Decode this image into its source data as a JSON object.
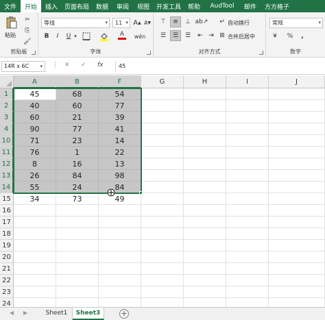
{
  "ribbon_tabs": [
    {
      "label": "文件",
      "active": false
    },
    {
      "label": "开始",
      "active": true
    },
    {
      "label": "插入",
      "active": false
    },
    {
      "label": "页面布局",
      "active": false
    },
    {
      "label": "数据",
      "active": false
    },
    {
      "label": "审阅",
      "active": false
    },
    {
      "label": "视图",
      "active": false
    },
    {
      "label": "开发工具",
      "active": false
    },
    {
      "label": "帮助",
      "active": false
    },
    {
      "label": "AudTool",
      "active": false
    },
    {
      "label": "邮件",
      "active": false
    },
    {
      "label": "方方格子",
      "active": false
    }
  ],
  "clipboard": {
    "paste_label": "粘贴",
    "group_label": "剪贴板"
  },
  "font": {
    "name": "等线",
    "size": "11",
    "group_label": "字体",
    "grow_label": "A",
    "shrink_label": "A",
    "bold": "B",
    "italic": "I",
    "underline": "U",
    "font_color_label": "A",
    "fill_color_label": "A"
  },
  "alignment": {
    "wrap_label": "自动换行",
    "merge_label": "合并后居中",
    "group_label": "对齐方式"
  },
  "number": {
    "format": "常规",
    "group_label": "数字",
    "percent": "%",
    "comma": ","
  },
  "formula_bar": {
    "name_box": "14R x 6C",
    "cancel": "✕",
    "enter": "✓",
    "fx": "fx",
    "value": "45"
  },
  "columns": [
    "A",
    "B",
    "F",
    "G",
    "H",
    "I",
    "J"
  ],
  "selected_columns": [
    "A",
    "B",
    "F"
  ],
  "rows": [
    {
      "num": "1",
      "cells": [
        "45",
        "68",
        "54"
      ],
      "selected": true
    },
    {
      "num": "2",
      "cells": [
        "40",
        "60",
        "77"
      ],
      "selected": true
    },
    {
      "num": "3",
      "cells": [
        "60",
        "21",
        "39"
      ],
      "selected": true
    },
    {
      "num": "4",
      "cells": [
        "90",
        "77",
        "41"
      ],
      "selected": true
    },
    {
      "num": "10",
      "cells": [
        "71",
        "23",
        "14"
      ],
      "selected": true
    },
    {
      "num": "11",
      "cells": [
        "76",
        "1",
        "22"
      ],
      "selected": true
    },
    {
      "num": "12",
      "cells": [
        "8",
        "16",
        "13"
      ],
      "selected": true
    },
    {
      "num": "13",
      "cells": [
        "26",
        "84",
        "98"
      ],
      "selected": true
    },
    {
      "num": "14",
      "cells": [
        "55",
        "24",
        "84"
      ],
      "selected": true
    },
    {
      "num": "15",
      "cells": [
        "34",
        "73",
        "49"
      ],
      "selected": false
    },
    {
      "num": "16",
      "cells": [
        "",
        "",
        ""
      ],
      "selected": false
    },
    {
      "num": "17",
      "cells": [
        "",
        "",
        ""
      ],
      "selected": false
    },
    {
      "num": "18",
      "cells": [
        "",
        "",
        ""
      ],
      "selected": false
    },
    {
      "num": "19",
      "cells": [
        "",
        "",
        ""
      ],
      "selected": false
    },
    {
      "num": "20",
      "cells": [
        "",
        "",
        ""
      ],
      "selected": false
    },
    {
      "num": "21",
      "cells": [
        "",
        "",
        ""
      ],
      "selected": false
    },
    {
      "num": "22",
      "cells": [
        "",
        "",
        ""
      ],
      "selected": false
    },
    {
      "num": "23",
      "cells": [
        "",
        "",
        ""
      ],
      "selected": false
    },
    {
      "num": "24",
      "cells": [
        "",
        "",
        ""
      ],
      "selected": false
    }
  ],
  "sheets": [
    {
      "label": "Sheet1",
      "active": false
    },
    {
      "label": "Sheet3",
      "active": true
    }
  ],
  "add_sheet": "+",
  "colors": {
    "accent": "#217346",
    "selection_fill": "#c6c6c6"
  }
}
